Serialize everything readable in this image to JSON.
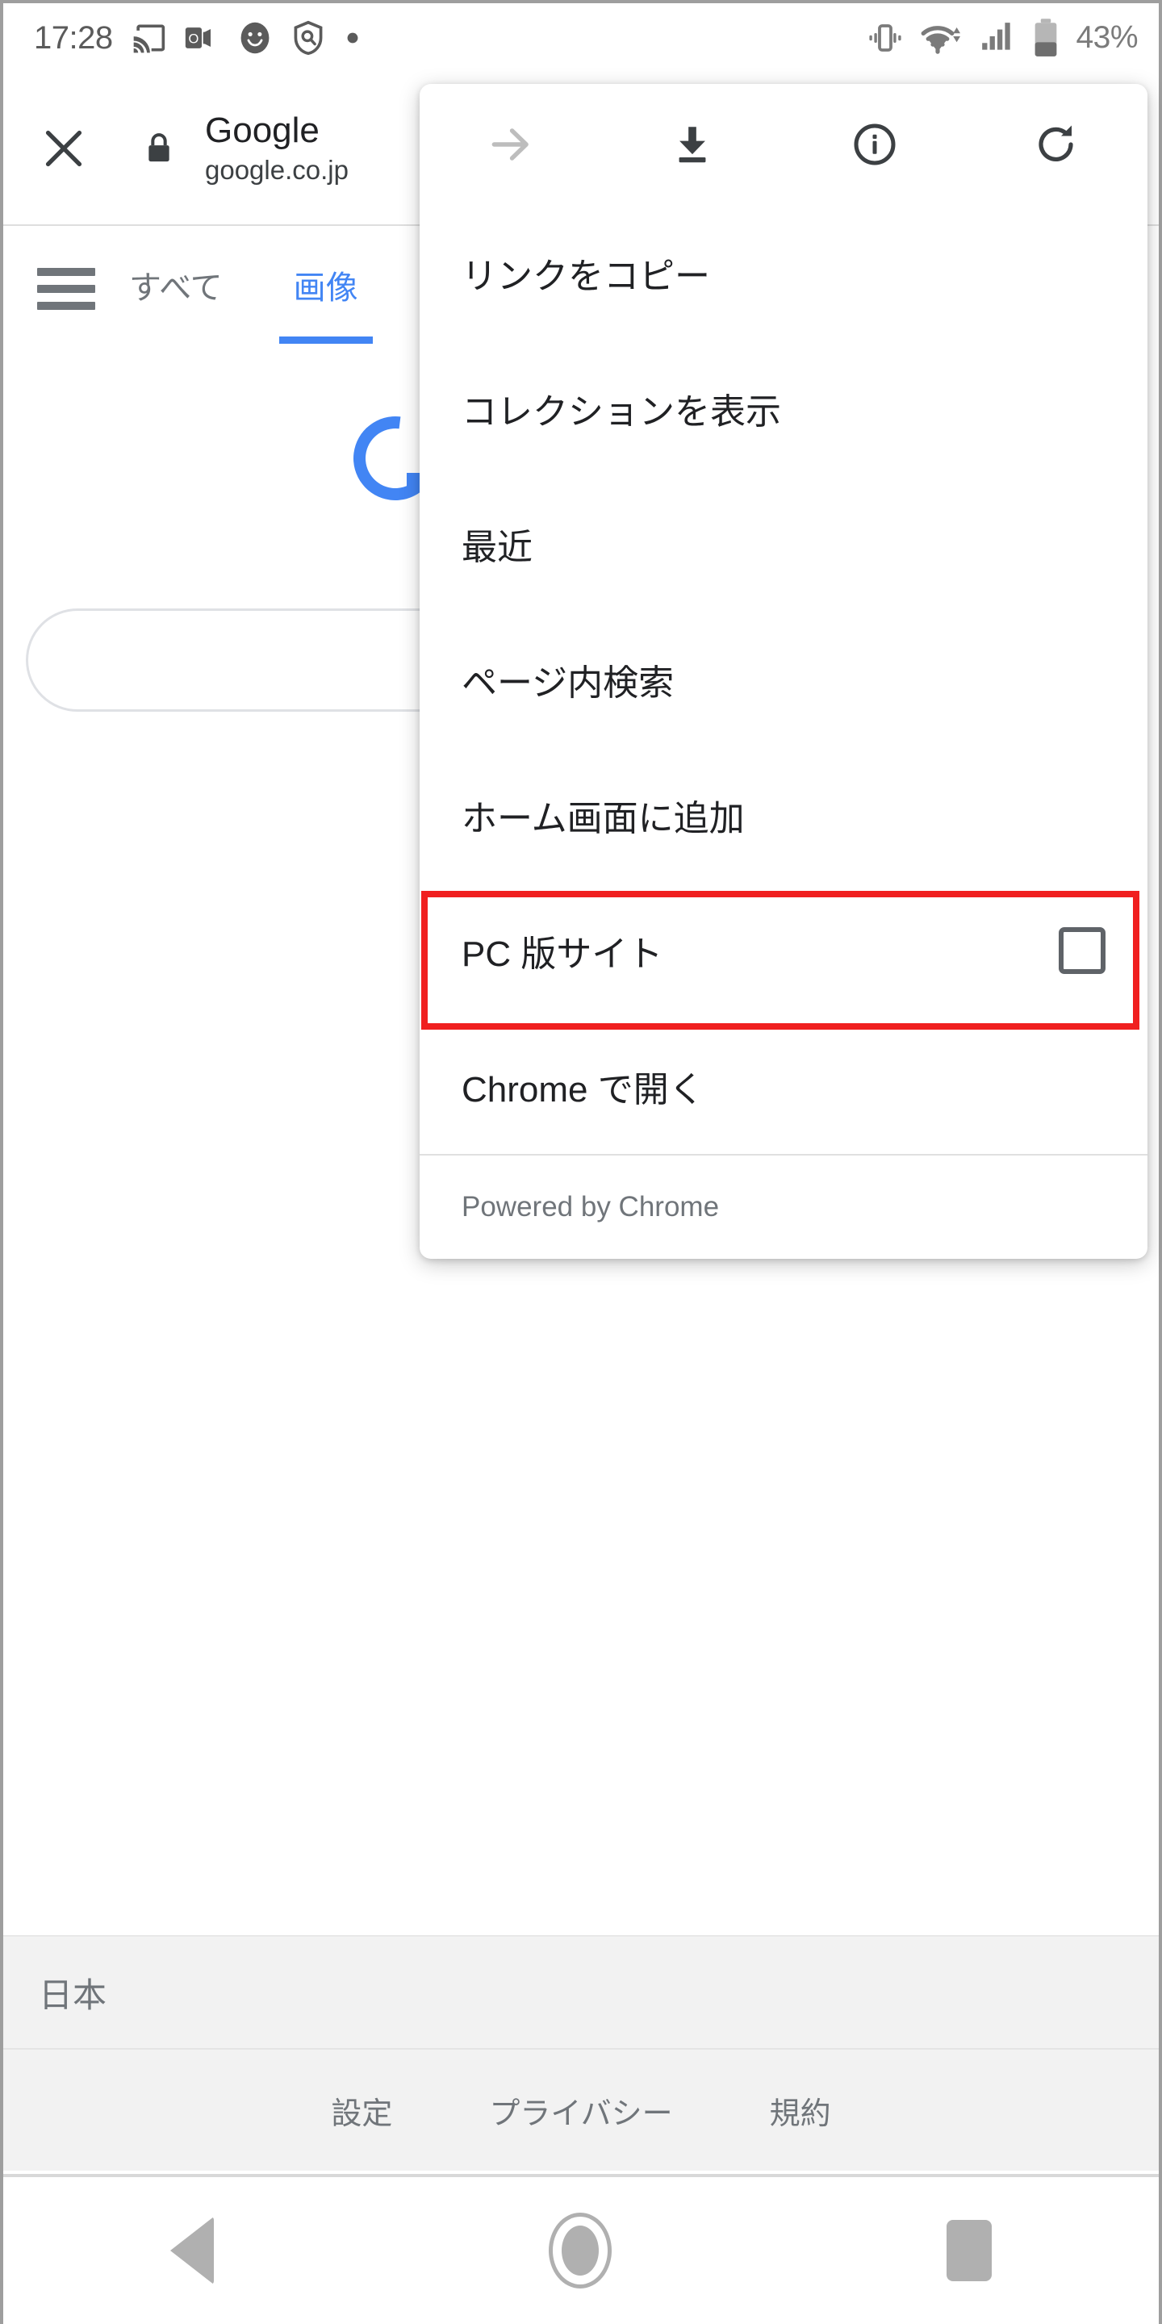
{
  "status_bar": {
    "time": "17:28",
    "battery_percent": "43%",
    "icons": [
      "cast-icon",
      "outlook-icon",
      "smiley-icon",
      "shield-search-icon",
      "dot-icon",
      "vibrate-icon",
      "wifi-icon",
      "cellular-signal-icon",
      "battery-icon"
    ]
  },
  "browser_bar": {
    "close_icon": "close-icon",
    "lock_icon": "lock-icon",
    "title": "Google",
    "url": "google.co.jp"
  },
  "page": {
    "menu_icon": "hamburger-icon",
    "tabs": [
      {
        "label": "すべて",
        "active": false
      },
      {
        "label": "画像",
        "active": true
      }
    ],
    "loading_spinner": "loading-spinner",
    "search_input_value": "",
    "search_input_placeholder": "",
    "footer": {
      "country": "日本",
      "links": [
        "設定",
        "プライバシー",
        "規約"
      ]
    }
  },
  "menu": {
    "header_icons": [
      {
        "name": "forward-arrow-icon",
        "disabled": true
      },
      {
        "name": "download-icon",
        "disabled": false
      },
      {
        "name": "info-icon",
        "disabled": false
      },
      {
        "name": "reload-icon",
        "disabled": false
      }
    ],
    "items": [
      {
        "label": "リンクをコピー",
        "type": "plain"
      },
      {
        "label": "コレクションを表示",
        "type": "plain"
      },
      {
        "label": "最近",
        "type": "plain"
      },
      {
        "label": "ページ内検索",
        "type": "plain"
      },
      {
        "label": "ホーム画面に追加",
        "type": "plain"
      },
      {
        "label": "PC 版サイト",
        "type": "checkbox",
        "checked": false,
        "highlighted": true
      },
      {
        "label": "Chrome で開く",
        "type": "plain"
      }
    ],
    "footer_text": "Powered by Chrome"
  },
  "nav_bar": {
    "back": "back-icon",
    "home": "home-icon",
    "recents": "recents-icon"
  },
  "colors": {
    "accent_blue": "#4285f4",
    "highlight_red": "#f01f1f",
    "text_primary": "#202124",
    "text_secondary": "#70757a"
  }
}
